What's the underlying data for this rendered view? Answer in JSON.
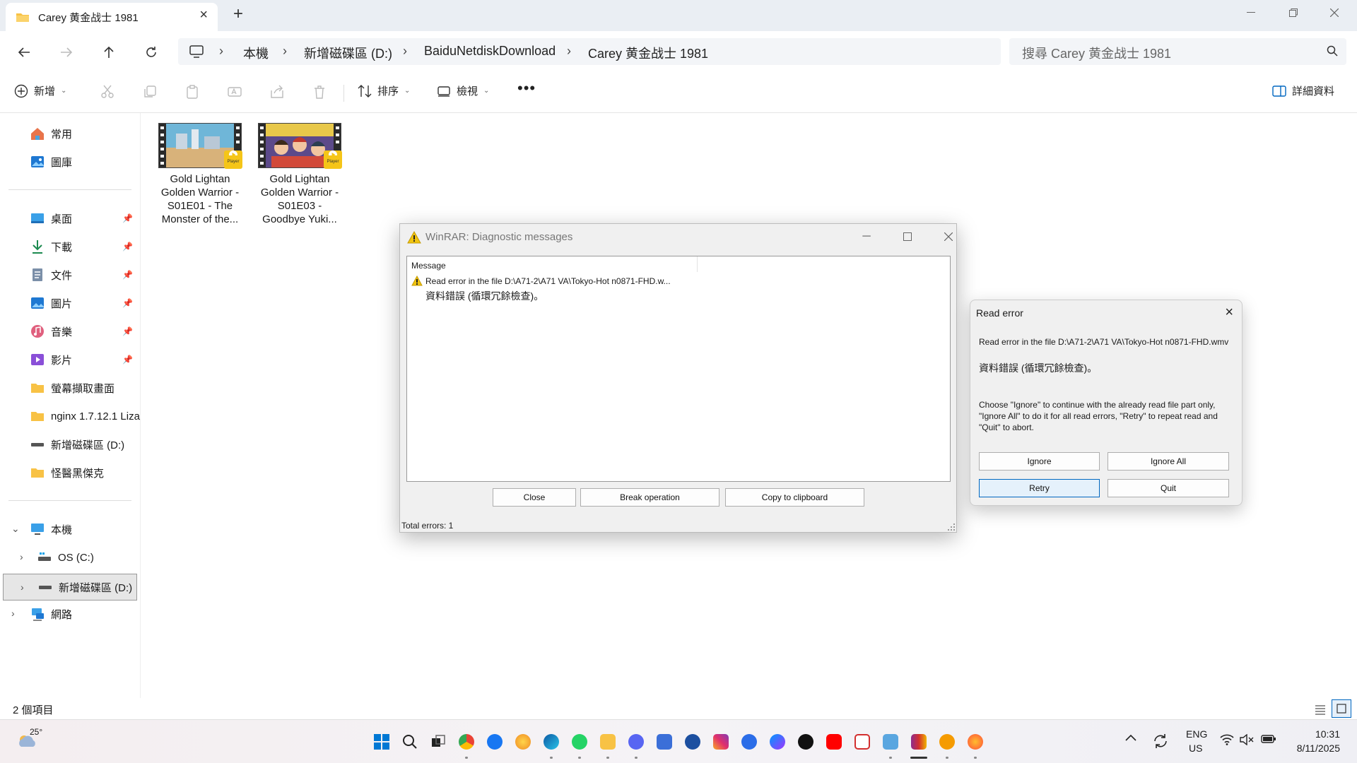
{
  "window": {
    "tab_title": "Carey 黄金战士 1981"
  },
  "address": {
    "crumbs": [
      "本機",
      "新增磁碟區 (D:)",
      "BaiduNetdiskDownload",
      "Carey 黄金战士 1981"
    ],
    "search_placeholder": "搜尋 Carey 黄金战士 1981"
  },
  "toolbar": {
    "new_label": "新增",
    "sort_label": "排序",
    "view_label": "檢視",
    "details_label": "詳細資料"
  },
  "sidebar": {
    "quick": [
      {
        "label": "常用",
        "icon": "home-icon"
      },
      {
        "label": "圖庫",
        "icon": "gallery-icon"
      }
    ],
    "pinned": [
      {
        "label": "桌面",
        "icon": "desktop-icon"
      },
      {
        "label": "下載",
        "icon": "download-icon"
      },
      {
        "label": "文件",
        "icon": "document-icon"
      },
      {
        "label": "圖片",
        "icon": "picture-icon"
      },
      {
        "label": "音樂",
        "icon": "music-icon"
      },
      {
        "label": "影片",
        "icon": "video-icon"
      },
      {
        "label": "螢幕擷取畫面",
        "icon": "folder-icon"
      },
      {
        "label": "nginx 1.7.12.1 Liza",
        "icon": "folder-icon"
      },
      {
        "label": "新增磁碟區 (D:)",
        "icon": "drive-icon"
      },
      {
        "label": "怪醫黑傑克",
        "icon": "folder-icon"
      }
    ],
    "tree": [
      {
        "label": "本機",
        "icon": "pc-icon"
      },
      {
        "label": "OS (C:)",
        "icon": "drive-c-icon"
      },
      {
        "label": "新增磁碟區 (D:)",
        "icon": "drive-icon"
      },
      {
        "label": "網路",
        "icon": "network-icon"
      }
    ]
  },
  "files": [
    {
      "name": "Gold Lightan Golden Warrior - S01E01 - The Monster of the...",
      "badge": "Player"
    },
    {
      "name": "Gold Lightan Golden Warrior - S01E03 - Goodbye Yuki...",
      "badge": "Player"
    }
  ],
  "status": {
    "item_count": "2 個項目"
  },
  "diag": {
    "title": "WinRAR: Diagnostic messages",
    "column_header": "Message",
    "line1": "Read error in the file D:\\A71-2\\A71 VA\\Tokyo-Hot n0871-FHD.w...",
    "line2": "資料錯誤 (循環冗餘檢查)。",
    "close": "Close",
    "break": "Break operation",
    "copy": "Copy to clipboard",
    "total": "Total errors: 1"
  },
  "read_error": {
    "title": "Read error",
    "path_text": "Read error in the file D:\\A71-2\\A71 VA\\Tokyo-Hot n0871-FHD.wmv",
    "detail": "資料錯誤 (循環冗餘檢查)。",
    "instructions": "Choose \"Ignore\" to continue with the already read file part only, \"Ignore All\" to do it for all read errors, \"Retry\" to repeat read and \"Quit\" to abort.",
    "ignore": "Ignore",
    "ignore_all": "Ignore All",
    "retry": "Retry",
    "quit": "Quit"
  },
  "taskbar": {
    "weather": "25°",
    "lang1": "ENG",
    "lang2": "US",
    "time": "10:31",
    "date": "8/11/2025"
  },
  "colors": {
    "accent": "#0067c0",
    "folder": "#f8c245",
    "warning": "#f1c40f"
  }
}
